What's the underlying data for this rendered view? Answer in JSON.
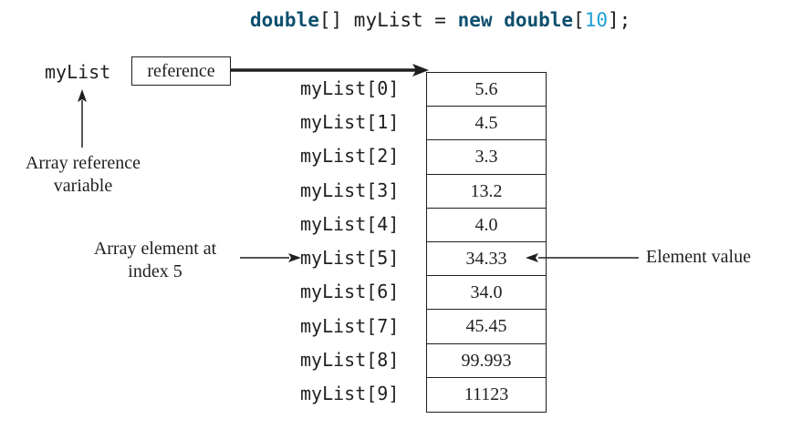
{
  "declaration": {
    "type_kw": "double",
    "brackets": "[] ",
    "var": "myList",
    "assign": " = ",
    "new_kw": "new",
    "space": " ",
    "type_kw2": "double",
    "open": "[",
    "size": "10",
    "close": "];"
  },
  "reference": {
    "var_name": "myList",
    "box_label": "reference",
    "caption_line1": "Array reference",
    "caption_line2": "variable"
  },
  "element_caption": {
    "line1": "Array element at",
    "line2": "index 5"
  },
  "value_caption": "Element value",
  "elements": [
    {
      "label": "myList[0]",
      "value": "5.6"
    },
    {
      "label": "myList[1]",
      "value": "4.5"
    },
    {
      "label": "myList[2]",
      "value": "3.3"
    },
    {
      "label": "myList[3]",
      "value": "13.2"
    },
    {
      "label": "myList[4]",
      "value": "4.0"
    },
    {
      "label": "myList[5]",
      "value": "34.33"
    },
    {
      "label": "myList[6]",
      "value": "34.0"
    },
    {
      "label": "myList[7]",
      "value": "45.45"
    },
    {
      "label": "myList[8]",
      "value": "99.993"
    },
    {
      "label": "myList[9]",
      "value": "11123"
    }
  ]
}
